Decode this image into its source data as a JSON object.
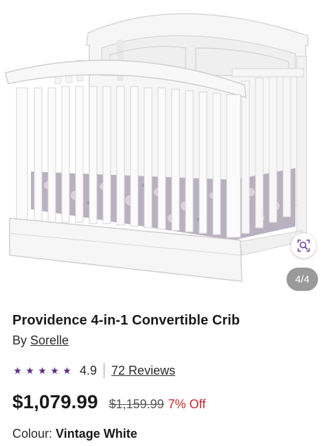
{
  "image": {
    "counter": "4/4",
    "visual_search_icon": "magnify-scan-icon"
  },
  "product": {
    "title": "Providence 4-in-1 Convertible Crib",
    "brand_prefix": "By ",
    "brand": "Sorelle",
    "rating": "4.9",
    "rating_fraction": 0.98,
    "reviews": "72 Reviews",
    "price": "$1,079.99",
    "was_price": "$1,159.99",
    "discount": "7% Off",
    "colour_label": "Colour: ",
    "colour_value": "Vintage White"
  },
  "colors": {
    "star": "#5b2a86",
    "discount": "#c4272b",
    "icon": "#6a3fa0"
  }
}
